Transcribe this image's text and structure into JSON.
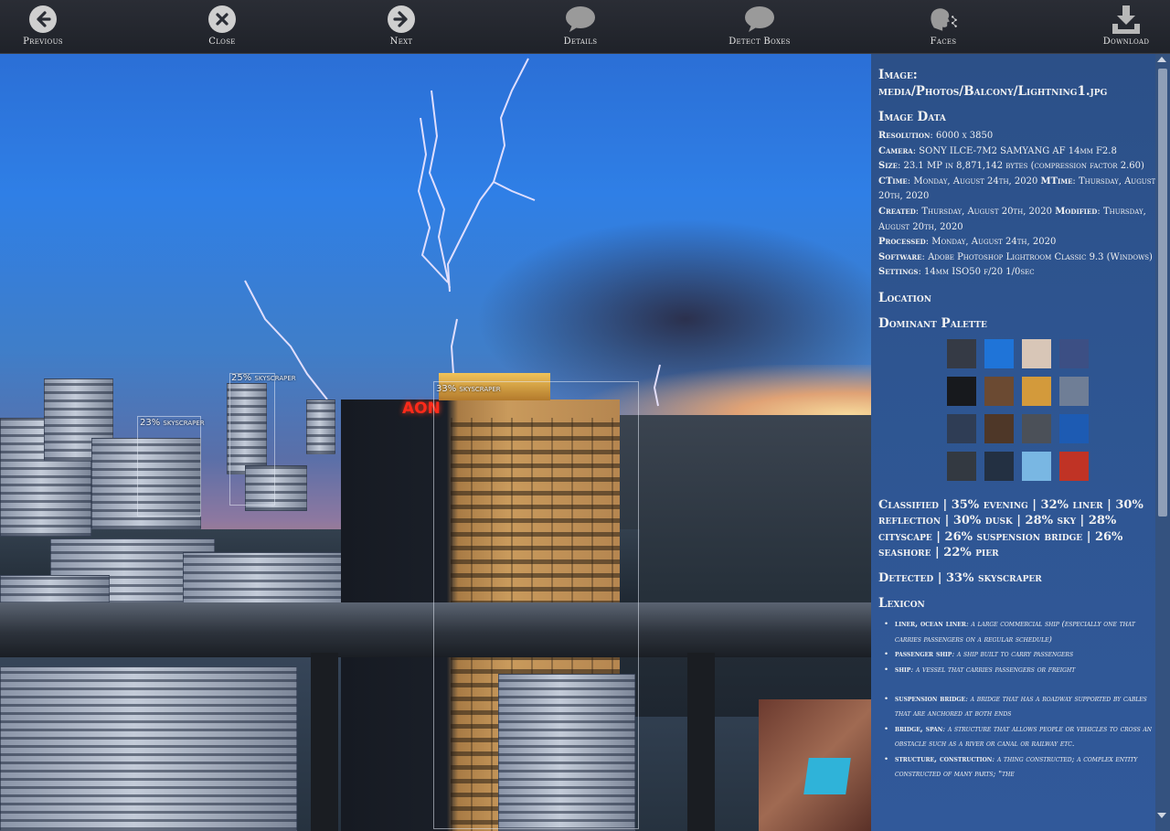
{
  "toolbar": {
    "previous": "Previous",
    "close": "Close",
    "next": "Next",
    "details": "Details",
    "detect_boxes": "Detect Boxes",
    "faces": "Faces",
    "download": "Download"
  },
  "photo": {
    "sign": "AON",
    "detections": [
      {
        "label": "25% skyscraper"
      },
      {
        "label": "23% skyscraper"
      },
      {
        "label": "33% skyscraper"
      }
    ]
  },
  "panel": {
    "image_heading": "Image:",
    "image_path": "media/Photos/Balcony/Lightning1.jpg",
    "image_data_heading": "Image Data",
    "meta": {
      "resolution_k": "Resolution",
      "resolution_v": "6000 x 3850",
      "camera_k": "Camera",
      "camera_v": "SONY ILCE-7M2 SAMYANG AF 14mm F2.8",
      "size_k": "Size",
      "size_v": "23.1 MP in 8,871,142 bytes (compression factor 2.60)",
      "ctime_k": "CTime",
      "ctime_v": "Monday, August 24th, 2020",
      "mtime_k": "MTime",
      "mtime_v": "Thursday, August 20th, 2020",
      "created_k": "Created",
      "created_v": "Thursday, August 20th, 2020",
      "modified_k": "Modified",
      "modified_v": "Thursday, August 20th, 2020",
      "processed_k": "Processed",
      "processed_v": "Monday, August 24th, 2020",
      "software_k": "Software",
      "software_v": "Adobe Photoshop Lightroom Classic 9.3 (Windows)",
      "settings_k": "Settings",
      "settings_v": "14mm ISO50 f/20 1/0sec"
    },
    "location_heading": "Location",
    "palette_heading": "Dominant Palette",
    "palette": [
      "#353a45",
      "#1f74d8",
      "#d8c6b7",
      "#3c4f84",
      "#17191d",
      "#6b4a32",
      "#d39a3b",
      "#6f7e96",
      "#2f3d55",
      "#4e3728",
      "#4b5058",
      "#1d5bb3",
      "#333941",
      "#233042",
      "#79b7e3",
      "#c03325"
    ],
    "classified_heading": "Classified",
    "classified_text": "35% evening | 32% liner | 30% reflection | 30% dusk | 28% sky | 28% cityscape | 26% suspension bridge | 26% seashore | 22% pier",
    "detected_heading": "Detected",
    "detected_text": "33% skyscraper",
    "lexicon_heading": "Lexicon",
    "lexicon": [
      {
        "term": "liner, ocean liner",
        "def": "a large commercial ship (especially one that carries passengers on a regular schedule)"
      },
      {
        "term": "passenger ship",
        "def": "a ship built to carry passengers"
      },
      {
        "term": "ship",
        "def": "a vessel that carries passengers or freight"
      },
      {
        "term": "suspension bridge",
        "def": "a bridge that has a roadway supported by cables that are anchored at both ends"
      },
      {
        "term": "bridge, span",
        "def": "a structure that allows people or vehicles to cross an obstacle such as a river or canal or railway etc."
      },
      {
        "term": "structure, construction",
        "def": "a thing constructed; a complex entity constructed of many parts; \"the"
      }
    ]
  }
}
